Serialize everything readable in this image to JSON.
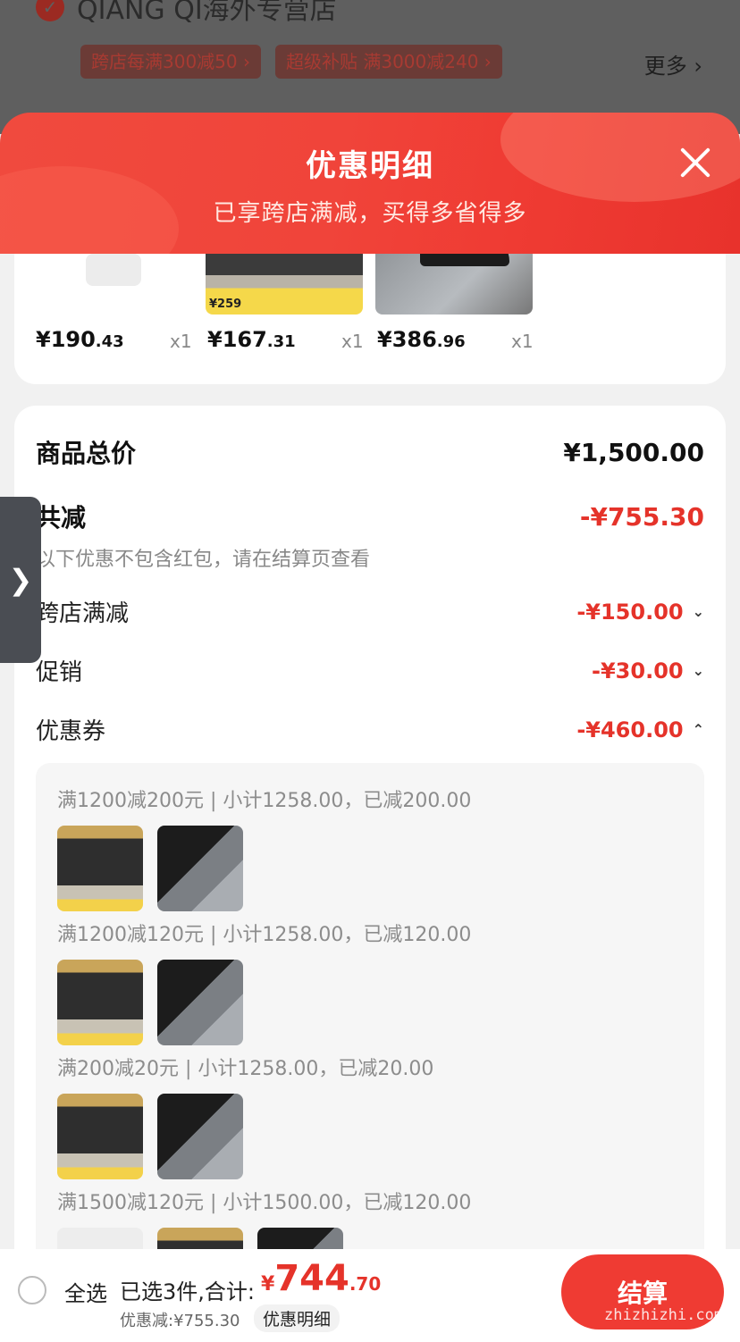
{
  "store": {
    "name": "QIANG QI海外专营店",
    "tags": [
      "跨店每满300减50 ›",
      "超级补贴 满3000减240 ›"
    ],
    "more": "更多 ›"
  },
  "sheet": {
    "title": "优惠明细",
    "subtitle": "已享跨店满减，买得多省得多",
    "thumb_price_label": "¥259",
    "products": [
      {
        "price_int": "¥190",
        "price_dec": ".43",
        "qty": "x1"
      },
      {
        "price_int": "¥167",
        "price_dec": ".31",
        "qty": "x1"
      },
      {
        "price_int": "¥386",
        "price_dec": ".96",
        "qty": "x1"
      }
    ]
  },
  "summary": {
    "total_label": "商品总价",
    "total_value": "¥1,500.00",
    "reduce_label": "共减",
    "reduce_value": "-¥755.30",
    "note": "以下优惠不包含红包，请在结算页查看",
    "items": [
      {
        "label": "跨店满减",
        "value": "-¥150.00"
      },
      {
        "label": "促销",
        "value": "-¥30.00"
      },
      {
        "label": "优惠券",
        "value": "-¥460.00"
      }
    ]
  },
  "coupons": [
    "满1200减200元 | 小计1258.00，已减200.00",
    "满1200减120元 | 小计1258.00，已减120.00",
    "满200减20元 | 小计1258.00，已减20.00",
    "满1500减120元 | 小计1500.00，已减120.00"
  ],
  "bottom": {
    "select_all": "全选",
    "selected": "已选3件,合计:",
    "currency": "¥",
    "total_int": "744",
    "total_dec": ".70",
    "saved": "优惠减:¥755.30",
    "detail": "优惠明细",
    "checkout": "结算",
    "watermark": "zhizhizhi.com"
  }
}
